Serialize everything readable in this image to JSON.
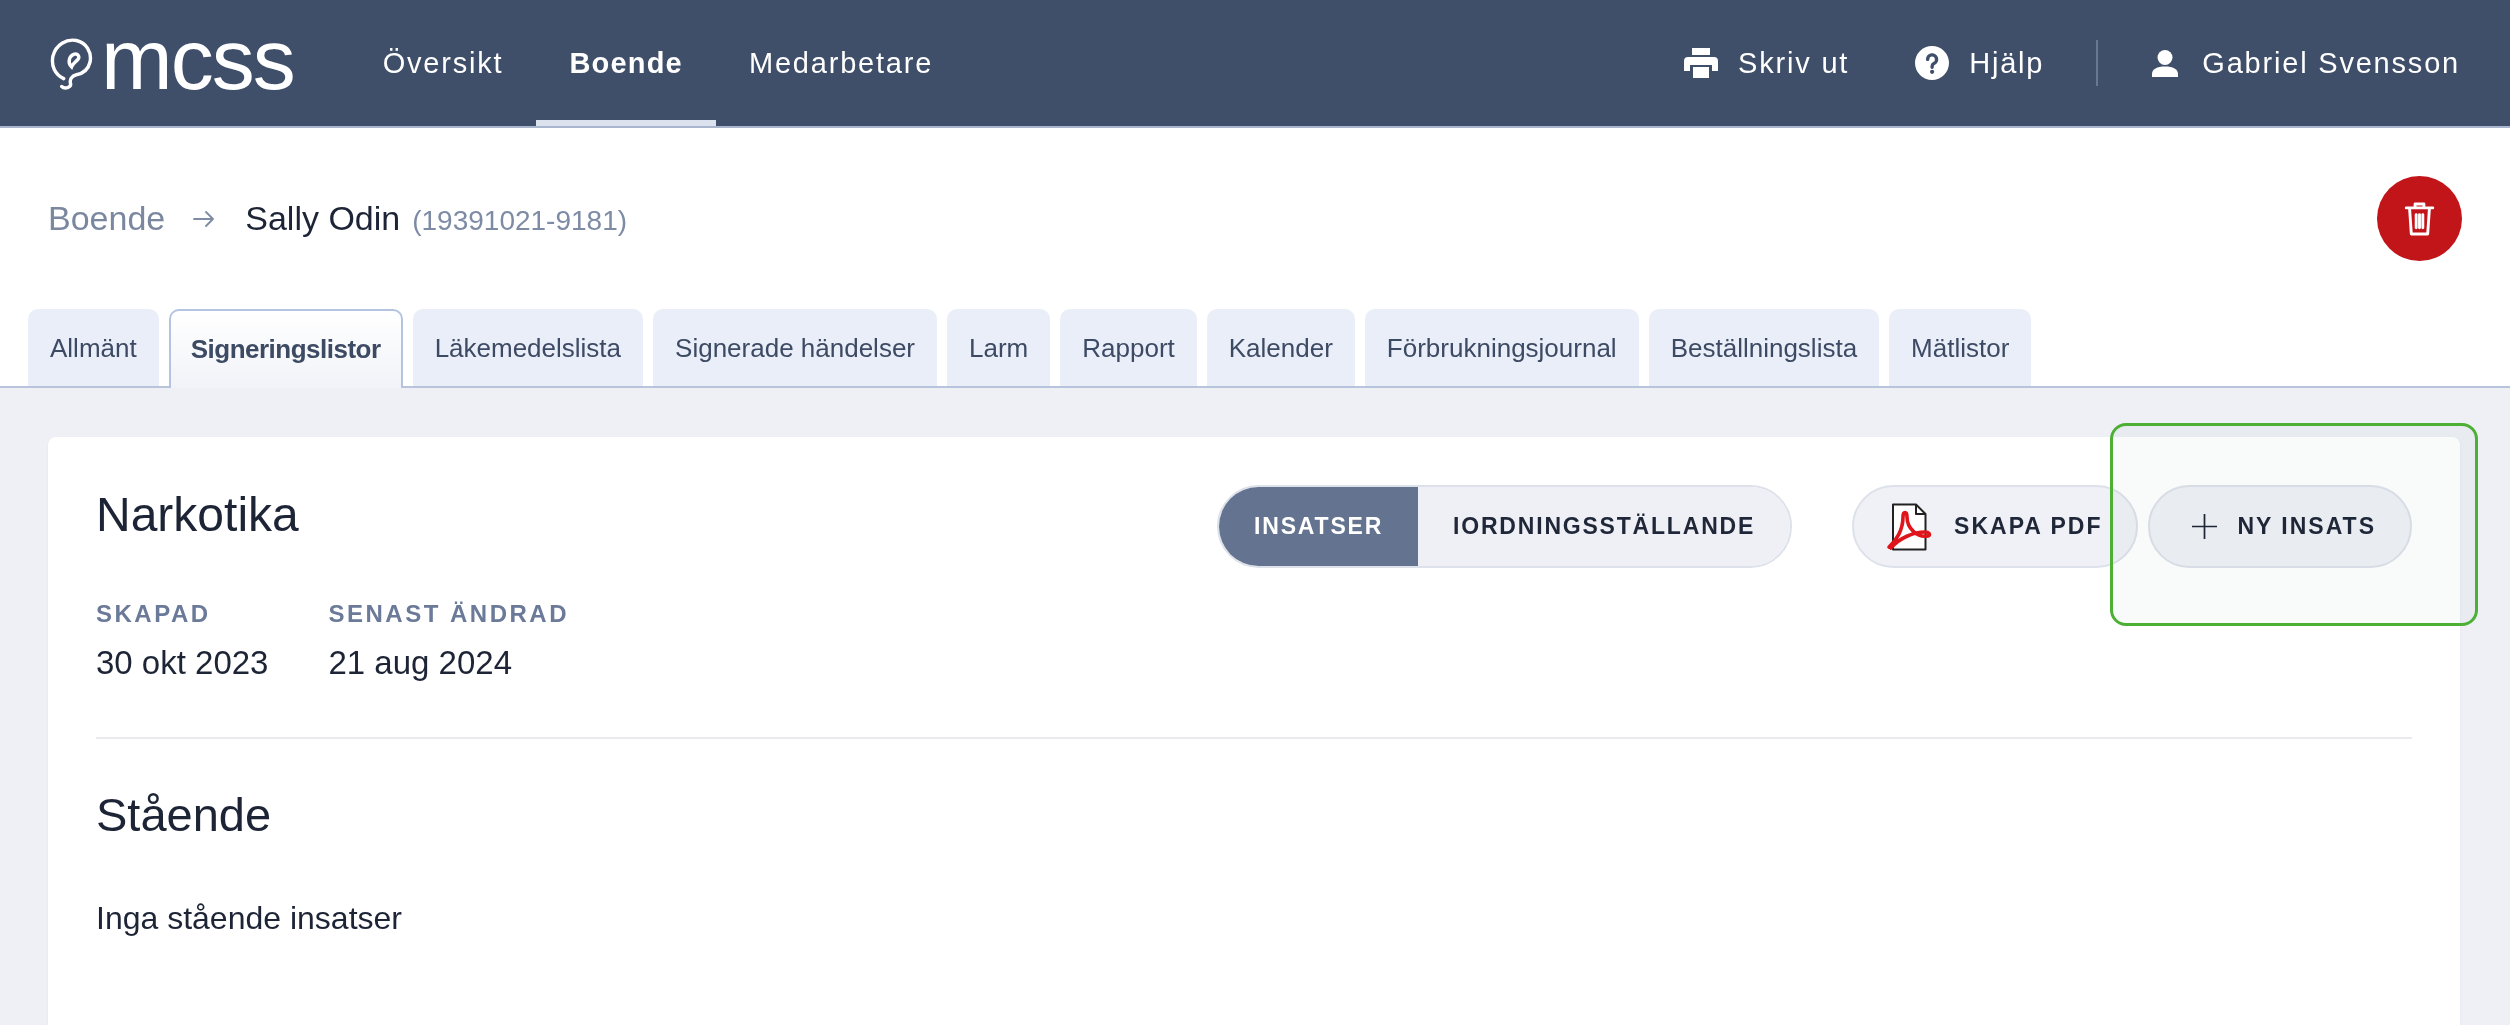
{
  "header": {
    "logo": "mcss",
    "nav": [
      {
        "label": "Översikt",
        "selected": false
      },
      {
        "label": "Boende",
        "selected": true
      },
      {
        "label": "Medarbetare",
        "selected": false
      }
    ],
    "actions": [
      {
        "kind": "print",
        "label": "Skriv ut"
      },
      {
        "kind": "help",
        "label": "Hjälp"
      }
    ],
    "user": {
      "name": "Gabriel Svensson"
    }
  },
  "breadcrumb": {
    "parent": "Boende",
    "current": "Sally Odin",
    "id_number": "(19391021-9181)"
  },
  "tabs": [
    {
      "label": "Allmänt",
      "selected": false
    },
    {
      "label": "Signeringslistor",
      "selected": true
    },
    {
      "label": "Läkemedelslista",
      "selected": false
    },
    {
      "label": "Signerade händelser",
      "selected": false
    },
    {
      "label": "Larm",
      "selected": false
    },
    {
      "label": "Rapport",
      "selected": false
    },
    {
      "label": "Kalender",
      "selected": false
    },
    {
      "label": "Förbrukningsjournal",
      "selected": false
    },
    {
      "label": "Beställningslista",
      "selected": false
    },
    {
      "label": "Mätlistor",
      "selected": false
    }
  ],
  "card": {
    "title": "Narkotika",
    "view_toggle": [
      {
        "label": "INSATSER",
        "selected": true
      },
      {
        "label": "IORDNINGSSTÄLLANDE",
        "selected": false
      }
    ],
    "buttons": [
      {
        "kind": "pdf",
        "label": "SKAPA PDF",
        "highlighted": false
      },
      {
        "kind": "add",
        "label": "NY INSATS",
        "highlighted": true
      }
    ],
    "meta": [
      {
        "label": "SKAPAD",
        "value": "30 okt 2023"
      },
      {
        "label": "SENAST ÄNDRAD",
        "value": "21 aug 2024"
      }
    ],
    "sections": [
      {
        "title": "Stående",
        "empty_text": "Inga stående insatser"
      }
    ]
  }
}
